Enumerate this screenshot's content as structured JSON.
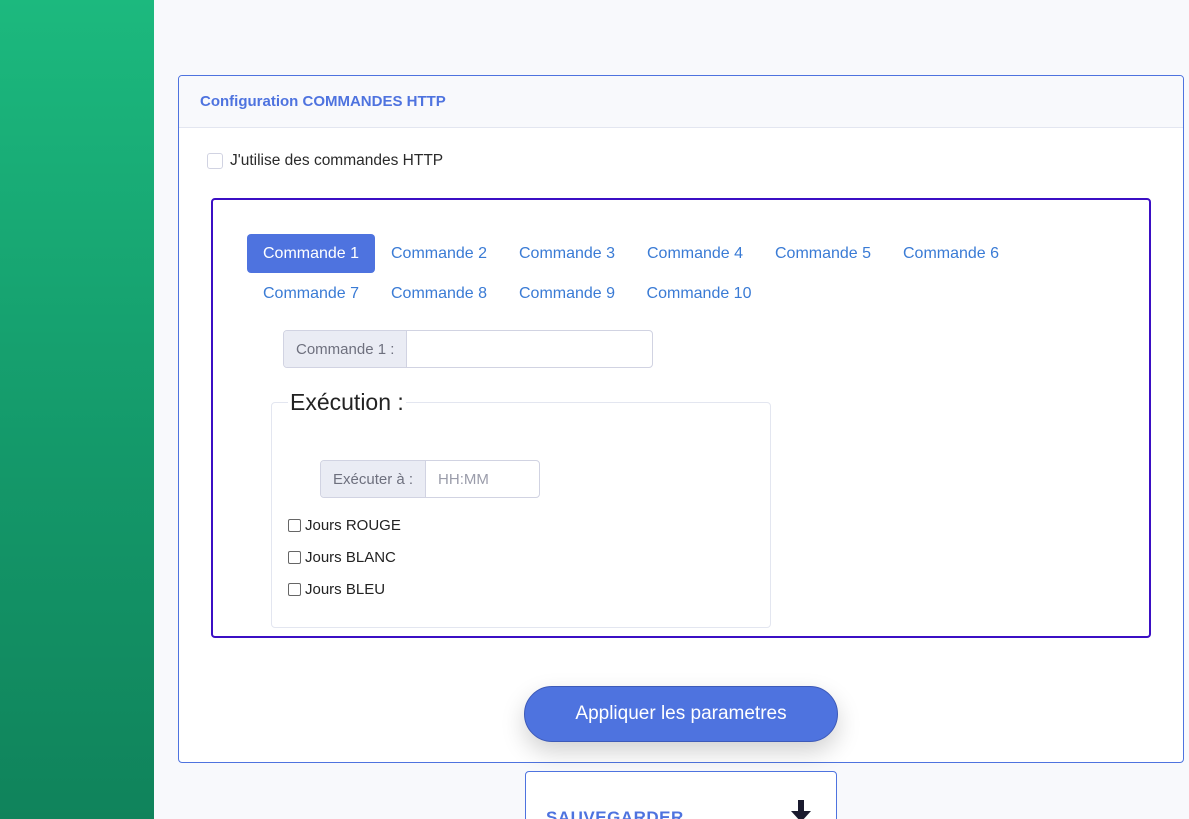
{
  "card": {
    "title": "Configuration COMMANDES HTTP"
  },
  "use_http": {
    "label": "J'utilise des commandes HTTP",
    "checked": false
  },
  "tabs": [
    {
      "label": "Commande 1",
      "active": true
    },
    {
      "label": "Commande 2",
      "active": false
    },
    {
      "label": "Commande 3",
      "active": false
    },
    {
      "label": "Commande 4",
      "active": false
    },
    {
      "label": "Commande 5",
      "active": false
    },
    {
      "label": "Commande 6",
      "active": false
    },
    {
      "label": "Commande 7",
      "active": false
    },
    {
      "label": "Commande 8",
      "active": false
    },
    {
      "label": "Commande 9",
      "active": false
    },
    {
      "label": "Commande 10",
      "active": false
    }
  ],
  "command_field": {
    "label": "Commande 1 :",
    "value": ""
  },
  "execution": {
    "legend": "Exécution :",
    "time_label": "Exécuter à :",
    "time_placeholder": "HH:MM",
    "days": [
      {
        "label": "Jours ROUGE",
        "checked": false
      },
      {
        "label": "Jours BLANC",
        "checked": false
      },
      {
        "label": "Jours BLEU",
        "checked": false
      }
    ]
  },
  "apply_button": {
    "label": "Appliquer les parametres"
  },
  "save_card": {
    "label": "SAUVEGARDER",
    "icon": "download-icon"
  },
  "colors": {
    "accent": "#4e73df",
    "sidebar": "#1cb97e",
    "inner_border": "#3b0fc4"
  }
}
